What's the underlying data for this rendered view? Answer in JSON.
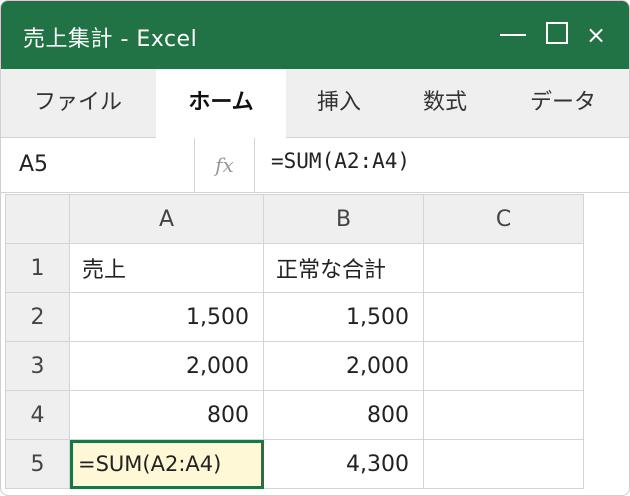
{
  "window": {
    "title": "売上集計 - Excel",
    "close_glyph": "×"
  },
  "ribbon": {
    "tabs": [
      {
        "label": "ファイル"
      },
      {
        "label": "ホーム"
      },
      {
        "label": "挿入"
      },
      {
        "label": "数式"
      },
      {
        "label": "データ"
      }
    ],
    "active": "ホーム"
  },
  "formula_bar": {
    "name_box": "A5",
    "fx_label": "fx",
    "formula": "=SUM(A2:A4)"
  },
  "sheet": {
    "columns": [
      "A",
      "B",
      "C"
    ],
    "rows": [
      {
        "num": "1",
        "A": "売上",
        "B": "正常な合計",
        "C": ""
      },
      {
        "num": "2",
        "A": "1,500",
        "B": "1,500",
        "C": ""
      },
      {
        "num": "3",
        "A": "2,000",
        "B": "2,000",
        "C": ""
      },
      {
        "num": "4",
        "A": "800",
        "B": "800",
        "C": ""
      },
      {
        "num": "5",
        "A": "=SUM(A2:A4)",
        "B": "4,300",
        "C": ""
      }
    ],
    "selected_cell": "A5"
  },
  "colors": {
    "accent": "#217346",
    "selected_fill": "#fff8d6",
    "header_bg": "#efefef"
  }
}
